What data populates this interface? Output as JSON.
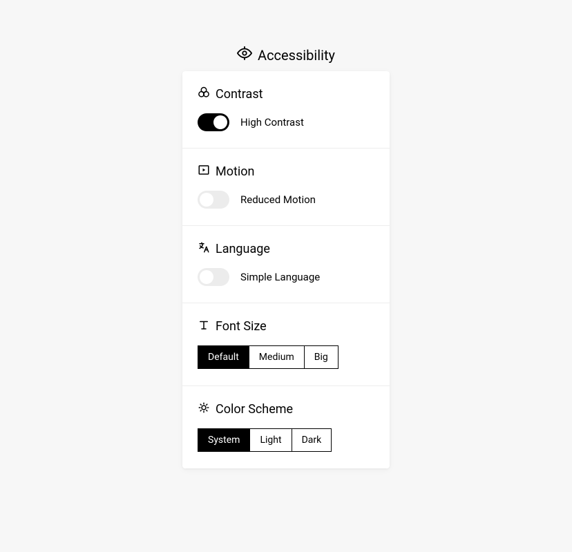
{
  "header": {
    "title": "Accessibility"
  },
  "sections": {
    "contrast": {
      "title": "Contrast",
      "toggle_label": "High Contrast",
      "on": true
    },
    "motion": {
      "title": "Motion",
      "toggle_label": "Reduced Motion",
      "on": false
    },
    "language": {
      "title": "Language",
      "toggle_label": "Simple Language",
      "on": false
    },
    "font_size": {
      "title": "Font Size",
      "options": [
        "Default",
        "Medium",
        "Big"
      ],
      "selected": "Default"
    },
    "color_scheme": {
      "title": "Color Scheme",
      "options": [
        "System",
        "Light",
        "Dark"
      ],
      "selected": "System"
    }
  }
}
